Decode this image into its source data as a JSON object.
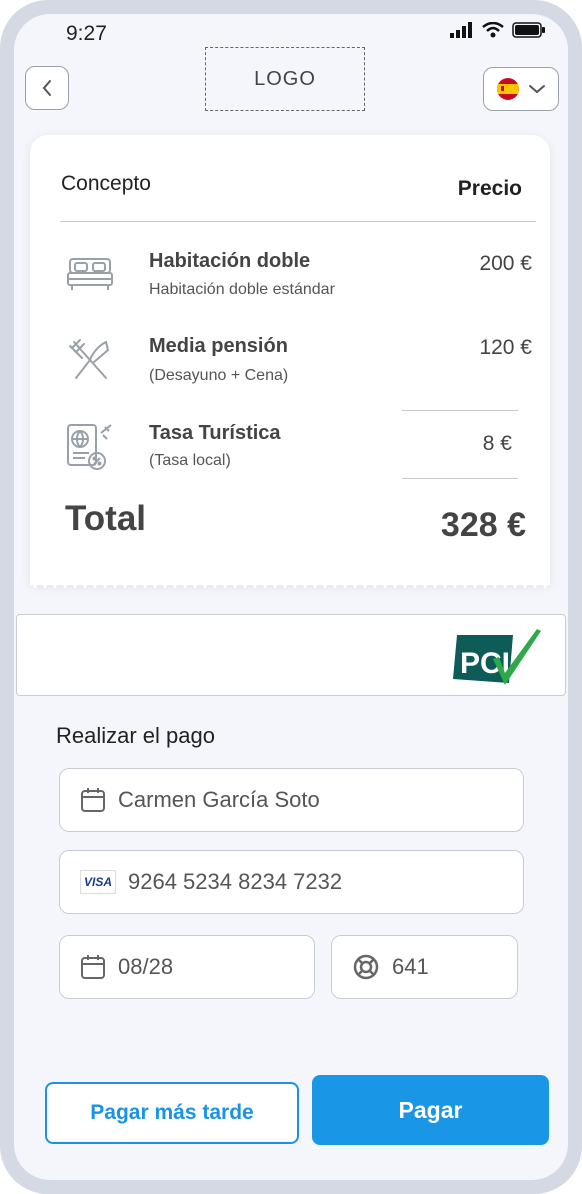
{
  "status_bar": {
    "time": "9:27"
  },
  "header": {
    "logo_text": "LOGO",
    "language_flag": "flag-spain-icon"
  },
  "receipt": {
    "column_concept": "Concepto",
    "column_price": "Precio",
    "items": [
      {
        "icon": "bed-icon",
        "title": "Habitación doble",
        "subtitle": "Habitación doble estándar",
        "price": "200 €"
      },
      {
        "icon": "cutlery-icon",
        "title": "Media pensión",
        "subtitle": "(Desayuno + Cena)",
        "price": "120 €"
      },
      {
        "icon": "tourist-tax-icon",
        "title": "Tasa Turística",
        "subtitle": "(Tasa local)",
        "price": "8 €"
      }
    ],
    "total_label": "Total",
    "total_value": "328 €"
  },
  "pci": {
    "logo_text": "PCI"
  },
  "payment": {
    "section_title": "Realizar el pago",
    "cardholder": "Carmen García Soto",
    "card_brand": "VISA",
    "card_number": "9264 5234 8234 7232",
    "expiry": "08/28",
    "cvv": "641"
  },
  "buttons": {
    "pay_later": "Pagar más tarde",
    "pay": "Pagar"
  },
  "colors": {
    "accent": "#1a96e6",
    "pci_green": "#2ea84a",
    "pci_teal": "#0d5c57"
  }
}
